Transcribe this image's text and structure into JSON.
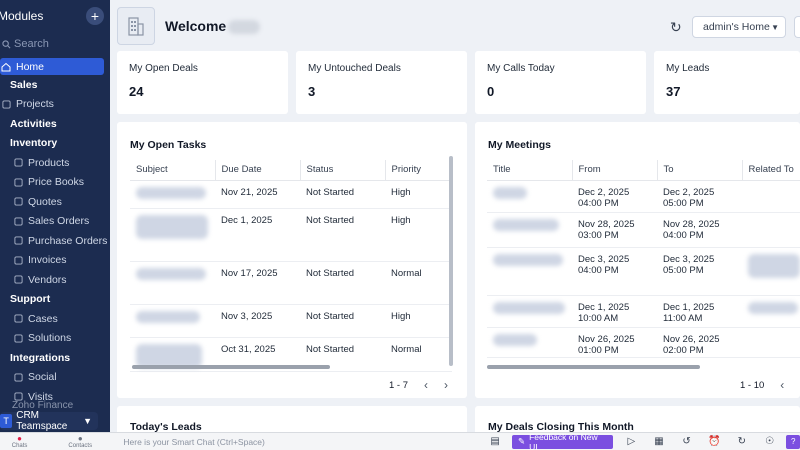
{
  "sidebar": {
    "title": "Modules",
    "search_placeholder": "Search",
    "home": "Home",
    "items": [
      {
        "label": "Sales",
        "type": "section"
      },
      {
        "label": "Projects",
        "type": "item",
        "icon": "projects-icon"
      },
      {
        "label": "Activities",
        "type": "section"
      },
      {
        "label": "Inventory",
        "type": "section"
      },
      {
        "label": "Products",
        "type": "sub",
        "icon": "products-icon"
      },
      {
        "label": "Price Books",
        "type": "sub",
        "icon": "price-books-icon"
      },
      {
        "label": "Quotes",
        "type": "sub",
        "icon": "quotes-icon"
      },
      {
        "label": "Sales Orders",
        "type": "sub",
        "icon": "sales-orders-icon"
      },
      {
        "label": "Purchase Orders",
        "type": "sub",
        "icon": "purchase-orders-icon"
      },
      {
        "label": "Invoices",
        "type": "sub",
        "icon": "invoices-icon"
      },
      {
        "label": "Vendors",
        "type": "sub",
        "icon": "vendors-icon"
      },
      {
        "label": "Support",
        "type": "section"
      },
      {
        "label": "Cases",
        "type": "sub",
        "icon": "cases-icon"
      },
      {
        "label": "Solutions",
        "type": "sub",
        "icon": "solutions-icon"
      },
      {
        "label": "Integrations",
        "type": "section"
      },
      {
        "label": "Social",
        "type": "sub",
        "icon": "social-icon"
      },
      {
        "label": "Visits",
        "type": "sub",
        "icon": "visits-icon"
      }
    ],
    "faded_item": "Zoho Finance",
    "team_badge": "T",
    "team_label": "CRM Teamspace"
  },
  "header": {
    "welcome": "Welcome",
    "home_select": "admin's Home"
  },
  "kpis": [
    {
      "label": "My Open Deals",
      "value": "24"
    },
    {
      "label": "My Untouched Deals",
      "value": "3"
    },
    {
      "label": "My Calls Today",
      "value": "0"
    },
    {
      "label": "My Leads",
      "value": "37"
    }
  ],
  "tasks": {
    "title": "My Open Tasks",
    "columns": [
      "Subject",
      "Due Date",
      "Status",
      "Priority"
    ],
    "rows": [
      {
        "due": "Nov 21, 2025",
        "status": "Not Started",
        "priority": "High"
      },
      {
        "due": "Dec 1, 2025",
        "status": "Not Started",
        "priority": "High"
      },
      {
        "due": "Nov 17, 2025",
        "status": "Not Started",
        "priority": "Normal"
      },
      {
        "due": "Nov 3, 2025",
        "status": "Not Started",
        "priority": "High"
      },
      {
        "due": "Oct 31, 2025",
        "status": "Not Started",
        "priority": "Normal"
      }
    ],
    "pager": "1 - 7"
  },
  "meetings": {
    "title": "My Meetings",
    "columns": [
      "Title",
      "From",
      "To",
      "Related To"
    ],
    "rows": [
      {
        "from_date": "Dec 2, 2025",
        "from_time": "04:00 PM",
        "to_date": "Dec 2, 2025",
        "to_time": "05:00 PM"
      },
      {
        "from_date": "Nov 28, 2025",
        "from_time": "03:00 PM",
        "to_date": "Nov 28, 2025",
        "to_time": "04:00 PM"
      },
      {
        "from_date": "Dec 3, 2025",
        "from_time": "04:00 PM",
        "to_date": "Dec 3, 2025",
        "to_time": "05:00 PM"
      },
      {
        "from_date": "Dec 1, 2025",
        "from_time": "10:00 AM",
        "to_date": "Dec 1, 2025",
        "to_time": "11:00 AM"
      },
      {
        "from_date": "Nov 26, 2025",
        "from_time": "01:00 PM",
        "to_date": "Nov 26, 2025",
        "to_time": "02:00 PM"
      }
    ],
    "pager": "1 - 10"
  },
  "bottom_panels": {
    "leads_title": "Today's Leads",
    "deals_title": "My Deals Closing This Month"
  },
  "bottombar": {
    "chats": "Chats",
    "contacts": "Contacts",
    "smart_chat": "Here is your Smart Chat (Ctrl+Space)",
    "feedback": "Feedback on New UI"
  },
  "colors": {
    "sidebar_bg": "#1c2c50",
    "accent": "#2e5bd6",
    "feedback": "#7b4fe0"
  }
}
